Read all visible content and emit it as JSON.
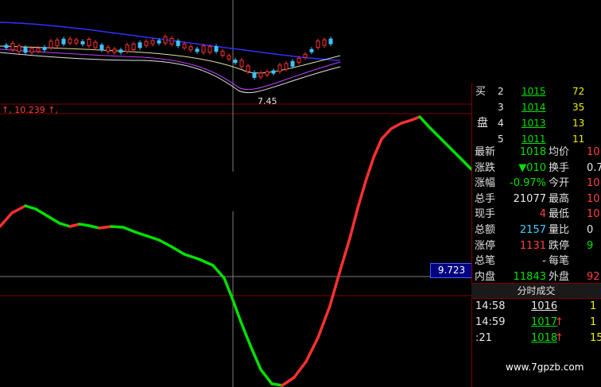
{
  "top_chart": {
    "title_line": "↑, 10.239 ↑,",
    "low_label": "7.45"
  },
  "price_tag": "9.723",
  "order_book": {
    "side_label_top": "买",
    "side_label_bottom": "盘",
    "rows": [
      {
        "idx": "2",
        "price": "1015",
        "vol": "72"
      },
      {
        "idx": "3",
        "price": "1014",
        "vol": "35"
      },
      {
        "idx": "4",
        "price": "1013",
        "vol": "13"
      },
      {
        "idx": "5",
        "price": "1011",
        "vol": "11"
      }
    ]
  },
  "quote": {
    "rows": [
      {
        "l1": "最新",
        "v1": "1018",
        "l2": "均价",
        "v2": "10"
      },
      {
        "l1": "涨跌",
        "v1": "▼010",
        "l2": "换手",
        "v2": "0.7"
      },
      {
        "l1": "涨幅",
        "v1": "-0.97%",
        "l2": "今开",
        "v2": "10"
      },
      {
        "l1": "总手",
        "v1": "21077",
        "l2": "最高",
        "v2": "10"
      },
      {
        "l1": "现手",
        "v1": "4",
        "l2": "最低",
        "v2": "10"
      },
      {
        "l1": "总额",
        "v1": "2157",
        "l2": "量比",
        "v2": "0"
      },
      {
        "l1": "涨停",
        "v1": "1131",
        "l2": "跌停",
        "v2": "9"
      },
      {
        "l1": "总笔",
        "v1": "-",
        "l2": "每笔",
        "v2": ""
      },
      {
        "l1": "内盘",
        "v1": "11843",
        "l2": "外盘",
        "v2": "92"
      }
    ]
  },
  "ticks": {
    "header": "分时成交",
    "rows": [
      {
        "time": "14:58",
        "price": "1016",
        "arrow": "",
        "vol": "1"
      },
      {
        "time": "14:59",
        "price": "1017",
        "arrow": "↑",
        "vol": "1"
      },
      {
        "time": ":21",
        "price": "1018",
        "arrow": "↑",
        "vol": "15"
      }
    ]
  },
  "watermark": "www.7gpzb.com",
  "colors": {
    "up": "#ff3030",
    "down": "#00e000",
    "ma_blue": "#3030ff",
    "grid_red": "#800000"
  }
}
